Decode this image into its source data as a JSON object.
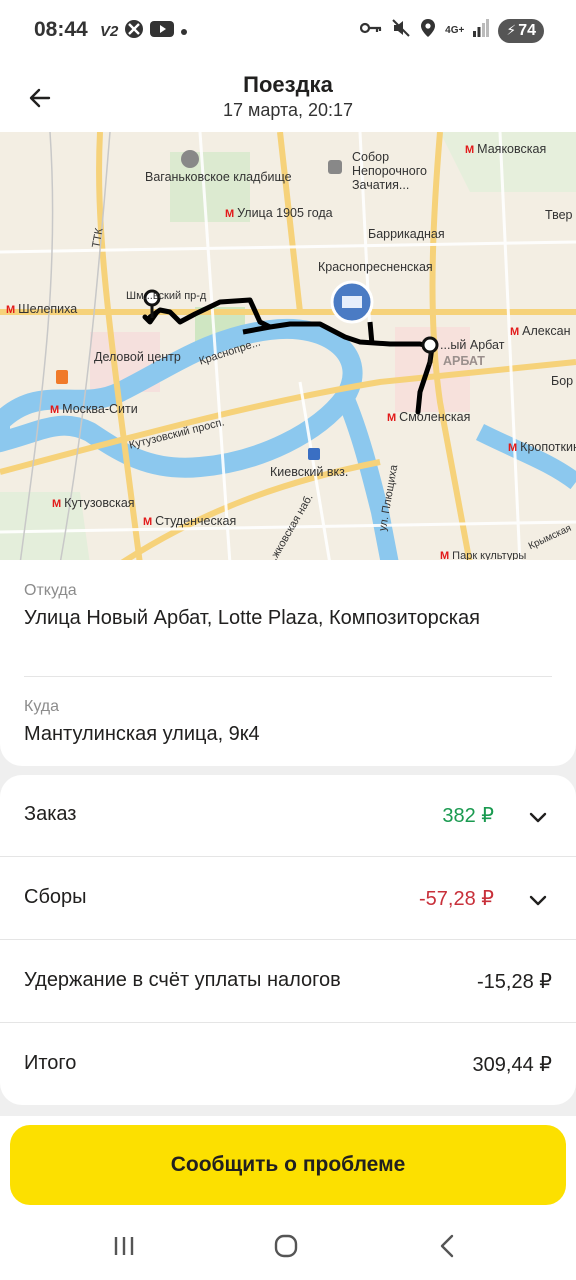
{
  "status_bar": {
    "time": "08:44",
    "left_badge": "V2",
    "network": "4G+",
    "battery": "74",
    "icons": [
      "vpn-key-icon",
      "mute-icon",
      "location-icon",
      "signal-icon",
      "battery-icon"
    ]
  },
  "header": {
    "title": "Поездка",
    "subtitle": "17 марта, 20:17"
  },
  "map": {
    "labels": {
      "vagankovskoe": "Ваганьковское кладбище",
      "sobor": "Собор Непорочного Зачатия...",
      "mayakovskaya": "Маяковская",
      "tver": "Твер",
      "ulitsa1905": "Улица 1905 года",
      "barrikadnaya": "Баррикадная",
      "krasnopresnenskaya": "Краснопресненская",
      "shelepikha": "Шелепиха",
      "shmitovsky": "Шм...вский пр-д",
      "delovoy": "Деловой центр",
      "krasnopresnenskaya_nab": "Краснопре...",
      "novy_arbat": "...ый Арбат",
      "arbat": "АРБАТ",
      "aleksan": "Алексан",
      "bor": "Бор",
      "moskva_siti": "Москва-Сити",
      "kutuzovsky_prosp": "Кутузовский просп.",
      "smolenskaya": "Смоленская",
      "kropotkin": "Кропоткин",
      "kievsky": "Киевский вкз.",
      "plyushchikha": "ул. Плющиха",
      "kutuzovskaya": "Кутузовская",
      "studencheskaya": "Студенческая",
      "berezhkovskaya": "...жковская наб.",
      "ttk": "ТТК",
      "park_kultury": "Парк культуры",
      "krymskaya": "Крымская"
    }
  },
  "trip": {
    "from_label": "Откуда",
    "from_value": "Улица Новый Арбат, Lotte Plaza, Композиторская",
    "to_label": "Куда",
    "to_value": "Мантулинская улица, 9к4"
  },
  "payment": {
    "order": {
      "label": "Заказ",
      "value": "382 ₽"
    },
    "fees": {
      "label": "Сборы",
      "value": "-57,28 ₽"
    },
    "tax": {
      "label": "Удержание в счёт уплаты налогов",
      "value": "-15,28 ₽"
    },
    "total": {
      "label": "Итого",
      "value": "309,44 ₽"
    }
  },
  "actions": {
    "report_problem": "Сообщить о проблеме"
  },
  "colors": {
    "accent_yellow": "#fce000",
    "positive_green": "#1a9a50",
    "negative_red": "#c8303a",
    "river_blue": "#7fc2ea",
    "route_black": "#000000"
  }
}
